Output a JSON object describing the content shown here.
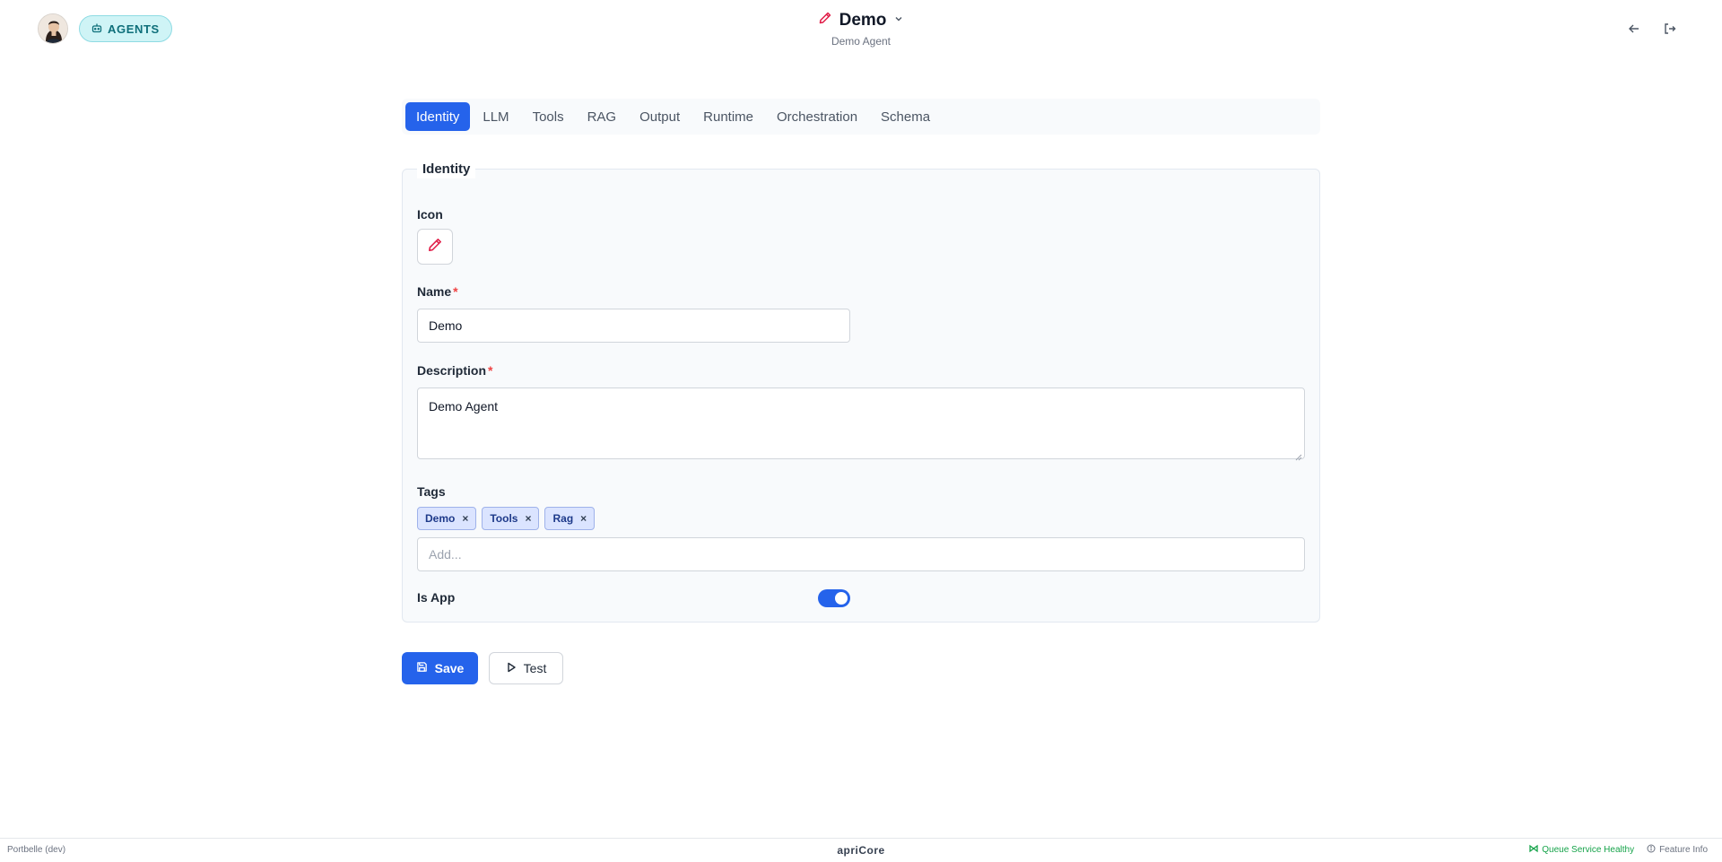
{
  "header": {
    "badge_label": "AGENTS",
    "title": "Demo",
    "subtitle": "Demo Agent",
    "icons": [
      "avatar",
      "robot-icon",
      "pencil-icon",
      "chevron-down-icon",
      "arrow-left-icon",
      "logout-icon"
    ]
  },
  "tabs": [
    {
      "label": "Identity",
      "active": true
    },
    {
      "label": "LLM"
    },
    {
      "label": "Tools"
    },
    {
      "label": "RAG"
    },
    {
      "label": "Output"
    },
    {
      "label": "Runtime"
    },
    {
      "label": "Orchestration"
    },
    {
      "label": "Schema"
    }
  ],
  "identity": {
    "legend": "Identity",
    "icon_label": "Icon",
    "name_label": "Name",
    "required_mark": "*",
    "name_value": "Demo",
    "description_label": "Description",
    "description_value": "Demo Agent",
    "tags_label": "Tags",
    "tags": [
      "Demo",
      "Tools",
      "Rag"
    ],
    "tag_remove": "×",
    "tags_placeholder": "Add...",
    "is_app_label": "Is App",
    "is_app": true
  },
  "actions": {
    "save_label": "Save",
    "test_label": "Test"
  },
  "footer": {
    "env": "Portbelle (dev)",
    "brand": "apriCore",
    "queue_status": "Queue Service Healthy",
    "feature_info": "Feature Info"
  },
  "colors": {
    "primary": "#2563eb",
    "badge_bg": "#cff4f6",
    "badge_text": "#0e6f7a",
    "icon_accent": "#e11d48",
    "required": "#ef4444",
    "healthy": "#16a34a"
  }
}
